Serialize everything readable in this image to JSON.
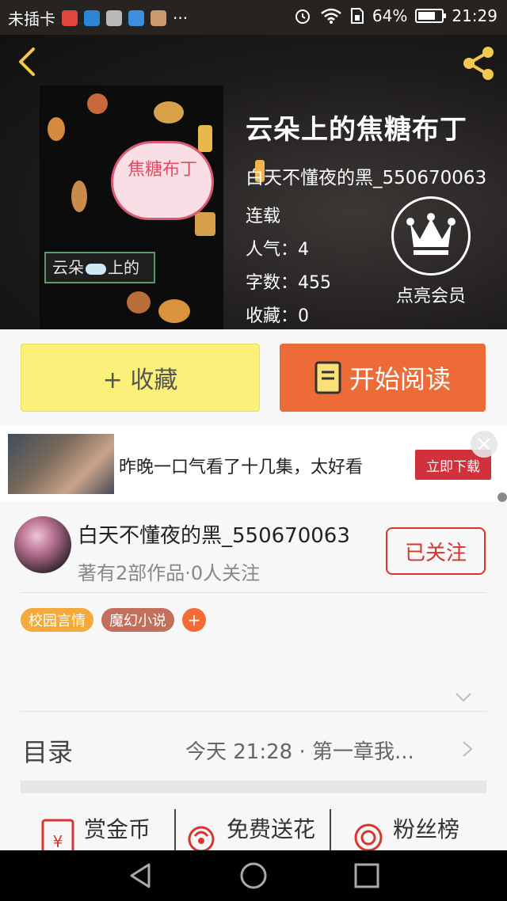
{
  "status_bar": {
    "carrier": "未插卡",
    "more": "···",
    "battery": "64%",
    "time": "21:29"
  },
  "book": {
    "title": "云朵上的焦糖布丁",
    "author": "白天不懂夜的黑_550670063",
    "status": "连载",
    "popularity": "人气：4",
    "word_count": "字数：455",
    "favorites": "收藏：0",
    "cover_text_top": "焦糖布丁",
    "cover_text_bottom_left": "云朵",
    "cover_text_bottom_right": "上的"
  },
  "vip": {
    "label": "点亮会员"
  },
  "actions": {
    "collect": "+ 收藏",
    "read": "开始阅读"
  },
  "ad": {
    "text": "昨晚一口气看了十几集，太好看",
    "button": "立即下载",
    "close": "×"
  },
  "author_card": {
    "name": "白天不懂夜的黑_550670063",
    "stats": "著有2部作品·0人关注",
    "follow": "已关注",
    "tags": [
      "校园言情",
      "魔幻小说"
    ],
    "tag_add": "+"
  },
  "toc": {
    "title": "目录",
    "latest": "今天 21:28 · 第一章我..."
  },
  "bottom_actions": {
    "reward": "赏金币",
    "flowers": "免费送花",
    "fans": "粉丝榜"
  },
  "colors": {
    "accent_orange": "#ed6b37",
    "collect_yellow": "#faf07a",
    "follow_red": "#d7362f",
    "tag_orange": "#f4a93b",
    "tag_brown": "#c2705b"
  },
  "icons": [
    "back-icon",
    "share-icon",
    "crown-icon",
    "book-icon",
    "red-envelope-icon",
    "flower-icon",
    "medal-icon",
    "nav-back-icon",
    "nav-home-icon",
    "nav-recents-icon"
  ]
}
